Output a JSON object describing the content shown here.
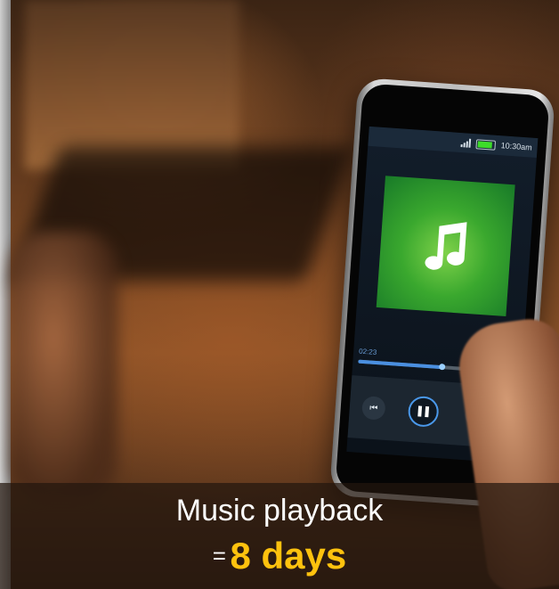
{
  "phone": {
    "status_time": "10:30am",
    "elapsed": "02:23",
    "progress_fraction": 0.55
  },
  "caption": {
    "line1": "Music playback",
    "equals": "=",
    "highlight": "8 days",
    "highlight_color": "#ffc20e"
  },
  "colors": {
    "album_green": "#3aa82e",
    "accent_blue": "#4a98ea"
  },
  "icons": {
    "signal": "signal-bars-icon",
    "battery": "battery-icon",
    "album": "music-note-icon",
    "prev": "skip-previous-icon",
    "pause": "pause-icon",
    "next": "skip-next-icon"
  }
}
